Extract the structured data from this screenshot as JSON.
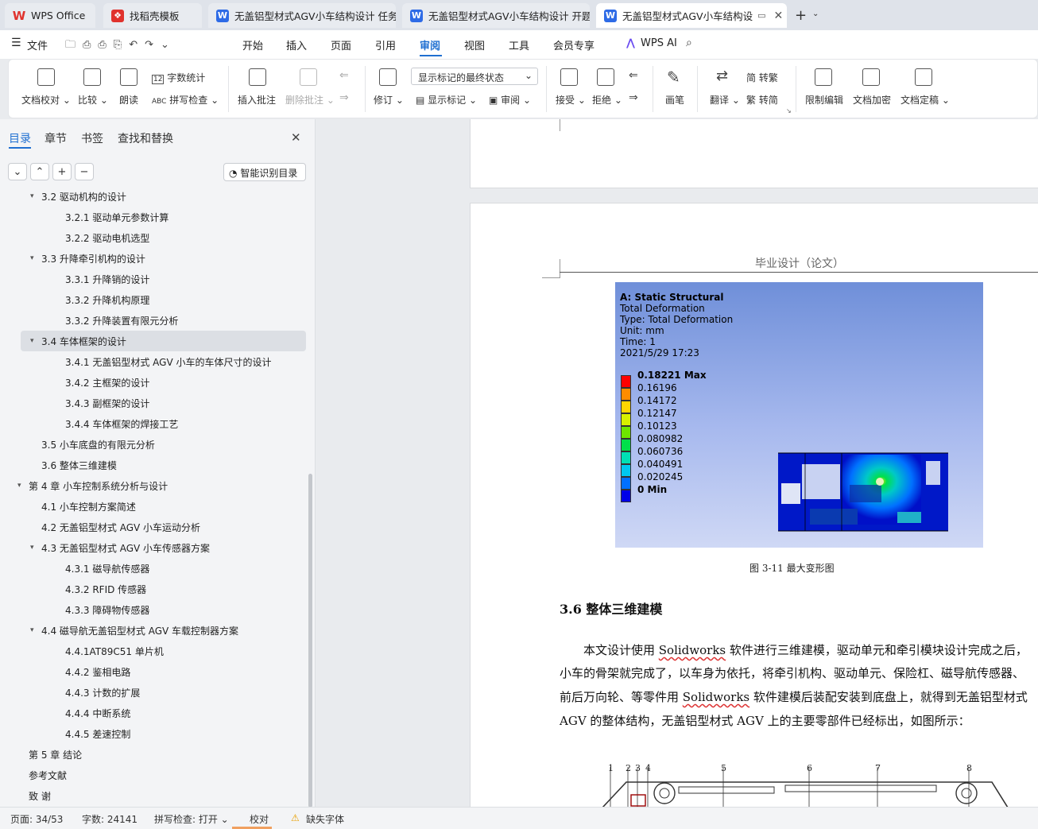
{
  "tabs": [
    {
      "label": "WPS Office",
      "icon": "wps-logo-icon",
      "color": "#e0322d"
    },
    {
      "label": "找稻壳模板",
      "icon": "docer-icon",
      "color": "#e0322d"
    },
    {
      "label": "无盖铝型材式AGV小车结构设计 任务",
      "icon": "writer-icon",
      "color": "#2e6be6"
    },
    {
      "label": "无盖铝型材式AGV小车结构设计 开题",
      "icon": "writer-icon",
      "color": "#2e6be6"
    },
    {
      "label": "无盖铝型材式AGV小车结构设",
      "icon": "writer-icon",
      "color": "#2e6be6"
    }
  ],
  "menu": {
    "file": "文件",
    "items": [
      "开始",
      "插入",
      "页面",
      "引用",
      "审阅",
      "视图",
      "工具",
      "会员专享"
    ],
    "selected": "审阅",
    "ai": "WPS AI"
  },
  "ribbon": {
    "doc_check": "文档校对",
    "compare": "比较",
    "read": "朗读",
    "word_count": "字数统计",
    "spell_check": "拼写检查",
    "insert_comment": "插入批注",
    "delete_comment": "删除批注",
    "track": "修订",
    "display_state": "显示标记的最终状态",
    "show_marks": "显示标记",
    "review": "审阅",
    "accept": "接受",
    "reject": "拒绝",
    "pen": "画笔",
    "translate": "翻译",
    "to_trad": "转繁",
    "to_simp": "转简",
    "restrict": "限制编辑",
    "encrypt": "文档加密",
    "finalize": "文档定稿"
  },
  "sidebar": {
    "tabs": [
      "目录",
      "章节",
      "书签",
      "查找和替换"
    ],
    "active_tab": "目录",
    "smart_toc": "智能识别目录",
    "items": [
      {
        "label": "3.2  驱动机构的设计",
        "level": 2,
        "arrow": "▾"
      },
      {
        "label": "3.2.1  驱动单元参数计算",
        "level": 3
      },
      {
        "label": "3.2.2  驱动电机选型",
        "level": 3
      },
      {
        "label": "3.3  升降牵引机构的设计",
        "level": 2,
        "arrow": "▾"
      },
      {
        "label": "3.3.1 升降销的设计",
        "level": 3
      },
      {
        "label": "3.3.2  升降机构原理",
        "level": 3
      },
      {
        "label": "3.3.2  升降装置有限元分析",
        "level": 3
      },
      {
        "label": "3.4  车体框架的设计",
        "level": 2,
        "arrow": "▾",
        "highlight": true
      },
      {
        "label": "3.4.1  无盖铝型材式 AGV 小车的车体尺寸的设计",
        "level": 3
      },
      {
        "label": "3.4.2  主框架的设计",
        "level": 3
      },
      {
        "label": "3.4.3  副框架的设计",
        "level": 3
      },
      {
        "label": "3.4.4  车体框架的焊接工艺",
        "level": 3
      },
      {
        "label": "3.5 小车底盘的有限元分析",
        "level": 2
      },
      {
        "label": "3.6  整体三维建模",
        "level": 2
      },
      {
        "label": "第 4 章  小车控制系统分析与设计",
        "level": 1,
        "arrow": "▾"
      },
      {
        "label": "4.1  小车控制方案简述",
        "level": 2
      },
      {
        "label": "4.2  无盖铝型材式 AGV 小车运动分析",
        "level": 2
      },
      {
        "label": "4.3  无盖铝型材式 AGV 小车传感器方案",
        "level": 2,
        "arrow": "▾"
      },
      {
        "label": "4.3.1 磁导航传感器",
        "level": 3
      },
      {
        "label": "4.3.2 RFID 传感器",
        "level": 3
      },
      {
        "label": "4.3.3  障碍物传感器",
        "level": 3
      },
      {
        "label": "4.4  磁导航无盖铝型材式 AGV 车载控制器方案",
        "level": 2,
        "arrow": "▾"
      },
      {
        "label": "4.4.1AT89C51 单片机",
        "level": 3
      },
      {
        "label": "4.4.2 鉴相电路",
        "level": 3
      },
      {
        "label": "4.4.3 计数的扩展",
        "level": 3
      },
      {
        "label": "4.4.4  中断系统",
        "level": 3
      },
      {
        "label": "4.4.5  差速控制",
        "level": 3
      },
      {
        "label": "第 5 章   结论",
        "level": 1
      },
      {
        "label": "参考文献",
        "level": 1
      },
      {
        "label": "致   谢",
        "level": 1
      }
    ]
  },
  "document": {
    "header": "毕业设计（论文）",
    "fem": {
      "title": "A: Static Structural",
      "lines": [
        "Total Deformation",
        "Type: Total Deformation",
        "Unit: mm",
        "Time: 1",
        "2021/5/29 17:23"
      ],
      "legend": [
        {
          "label": "0.18221 Max",
          "color": "#ff0000",
          "bold": true
        },
        {
          "label": "0.16196",
          "color": "#ff8c00"
        },
        {
          "label": "0.14172",
          "color": "#ffd500"
        },
        {
          "label": "0.12147",
          "color": "#d8f000"
        },
        {
          "label": "0.10123",
          "color": "#6ee600"
        },
        {
          "label": "0.080982",
          "color": "#00e04a"
        },
        {
          "label": "0.060736",
          "color": "#00e0b4"
        },
        {
          "label": "0.040491",
          "color": "#00c8f0"
        },
        {
          "label": "0.020245",
          "color": "#0070ff"
        },
        {
          "label": "0 Min",
          "color": "#0000e8",
          "bold": true
        }
      ]
    },
    "figure_caption": "图 3-11    最大变形图",
    "section_title": "3.6  整体三维建模",
    "para": [
      {
        "segments": [
          {
            "t": "本文设计使用 "
          },
          {
            "t": "Solidworks",
            "w": true
          },
          {
            "t": " 软件进行三维建模，驱动单元和牵引模块设计完成之后，"
          }
        ]
      },
      {
        "segments": [
          {
            "t": "小车的骨架就完成了，以车身为依托，将牵引机构、驱动单元、保险杠、磁导航传感器、"
          }
        ]
      },
      {
        "segments": [
          {
            "t": "前后万向轮、等零件用 "
          },
          {
            "t": "Solidworks",
            "w": true
          },
          {
            "t": " 软件建模后装配安装到底盘上，就得到无盖铝型材式"
          }
        ]
      },
      {
        "segments": [
          {
            "t": "AGV 的整体结构，无盖铝型材式 AGV 上的主要零部件已经标出，如图所示："
          }
        ]
      }
    ],
    "drawing_labels": [
      "1",
      "2",
      "3",
      "4",
      "5",
      "6",
      "7",
      "8"
    ]
  },
  "status": {
    "page": "页面: 34/53",
    "words": "字数: 24141",
    "spell": "拼写检查: 打开",
    "proof": "校对",
    "missing_font": "缺失字体"
  }
}
